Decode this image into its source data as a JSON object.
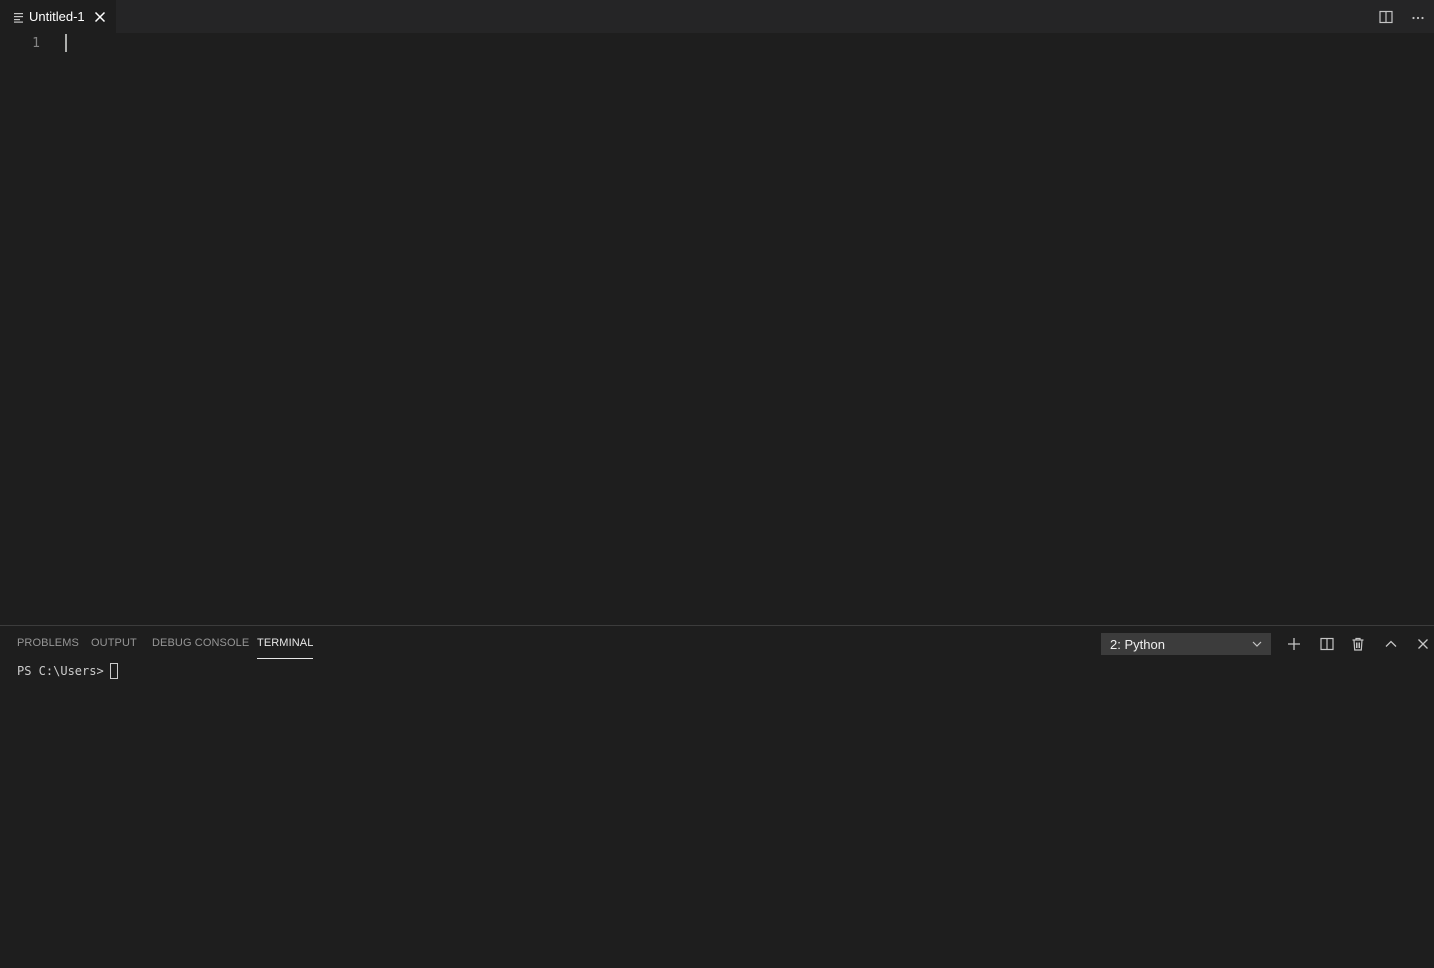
{
  "editor": {
    "tab": {
      "label": "Untitled-1",
      "icon": "file-lines-icon",
      "close_icon": "close-icon"
    },
    "actions": [
      {
        "name": "split-editor",
        "icon": "split-editor-icon"
      },
      {
        "name": "more-actions",
        "icon": "ellipsis-icon"
      }
    ],
    "line_numbers": [
      "1"
    ]
  },
  "panel": {
    "tabs": [
      {
        "label": "PROBLEMS",
        "active": false
      },
      {
        "label": "OUTPUT",
        "active": false
      },
      {
        "label": "DEBUG CONSOLE",
        "active": false
      },
      {
        "label": "TERMINAL",
        "active": true
      }
    ],
    "terminal_select": {
      "value": "2: Python",
      "icon": "chevron-down-icon"
    },
    "actions": [
      {
        "name": "new-terminal",
        "icon": "plus-icon"
      },
      {
        "name": "split-terminal",
        "icon": "split-icon"
      },
      {
        "name": "kill-terminal",
        "icon": "trash-icon"
      },
      {
        "name": "maximize-panel",
        "icon": "chevron-up-icon"
      },
      {
        "name": "close-panel",
        "icon": "close-icon"
      }
    ],
    "terminal": {
      "prompt": "PS C:\\Users>"
    }
  },
  "colors": {
    "background": "#1e1e1e",
    "tabbar_background": "#252526",
    "panel_border": "#3c3c3c",
    "active_text": "#e7e7e7",
    "inactive_text": "#969696",
    "line_number": "#858585",
    "dropdown_background": "#3c3c3c"
  }
}
